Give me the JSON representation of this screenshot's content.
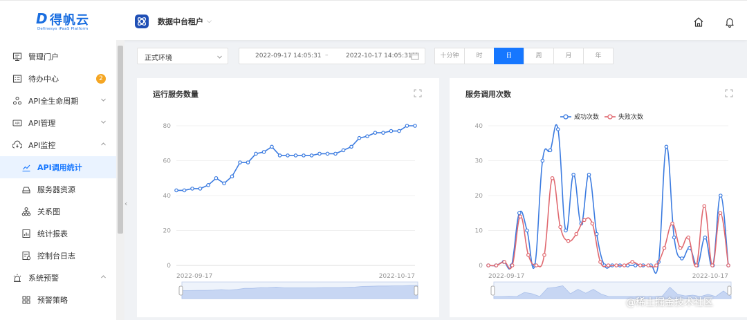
{
  "brand": {
    "mark": "D",
    "name": "得帆云",
    "subtitle": "Definesys iPaaS Platform"
  },
  "header": {
    "tenant": "数据中台租户",
    "home_icon": "home-icon",
    "bell_icon": "bell-icon"
  },
  "sidebar": {
    "items": [
      {
        "label": "管理门户",
        "icon": "monitor-icon"
      },
      {
        "label": "待办中心",
        "icon": "todo-icon",
        "badge": "2"
      },
      {
        "label": "API全生命周期",
        "icon": "lifecycle-icon",
        "expandable": true
      },
      {
        "label": "API管理",
        "icon": "api-icon",
        "expandable": true
      },
      {
        "label": "API监控",
        "icon": "cloud-monitor-icon",
        "expanded": true
      },
      {
        "label": "API调用统计",
        "icon": "chart-icon",
        "sub": true,
        "active": true
      },
      {
        "label": "服务器资源",
        "icon": "server-icon",
        "sub": true
      },
      {
        "label": "关系图",
        "icon": "relation-icon",
        "sub": true
      },
      {
        "label": "统计报表",
        "icon": "report-icon",
        "sub": true
      },
      {
        "label": "控制台日志",
        "icon": "log-icon",
        "sub": true
      },
      {
        "label": "系统预警",
        "icon": "alarm-icon",
        "expanded": true
      },
      {
        "label": "预警策略",
        "icon": "grid-icon",
        "sub": true
      }
    ]
  },
  "filters": {
    "environment": "正式环境",
    "date_start": "2022-09-17 14:05:31",
    "date_separator": "–",
    "date_end": "2022-10-17 14:05:31",
    "granularity": [
      "十分钟",
      "时",
      "日",
      "周",
      "月",
      "年"
    ],
    "granularity_active": "日"
  },
  "colors": {
    "primary": "#1677ff",
    "success_series": "#3b7be0",
    "fail_series": "#e0686f",
    "badge": "#f5a623"
  },
  "chart_data": [
    {
      "type": "line",
      "title": "运行服务数量",
      "ylim": [
        0,
        80
      ],
      "yticks": [
        0,
        20,
        40,
        60,
        80
      ],
      "xlabels": [
        "2022-09-17",
        "2022-10-17"
      ],
      "series": [
        {
          "values": [
            43,
            43,
            44,
            44,
            46,
            50,
            47,
            51,
            59,
            59,
            64,
            65,
            68,
            63,
            63,
            63,
            63,
            63,
            64,
            64,
            64,
            66,
            68,
            73,
            74,
            76,
            76,
            77,
            77,
            80,
            80
          ]
        }
      ]
    },
    {
      "type": "line",
      "title": "服务调用次数",
      "ylim": [
        0,
        40
      ],
      "yticks": [
        0,
        10,
        20,
        30,
        40
      ],
      "xlabels": [
        "2022-09-17",
        "2022-10-17"
      ],
      "legend": "top",
      "series": [
        {
          "name": "成功次数",
          "values": [
            0,
            0,
            1,
            0,
            15,
            10,
            0,
            30,
            33,
            39,
            10,
            26,
            12,
            26,
            9,
            0,
            0,
            0,
            0,
            0,
            0,
            0,
            1,
            34,
            8,
            2,
            5,
            0,
            8,
            0,
            20,
            0
          ]
        },
        {
          "name": "失败次数",
          "values": [
            0,
            0,
            1,
            0,
            14,
            3,
            0,
            3,
            25,
            11,
            7,
            9,
            13,
            12,
            1,
            0,
            0,
            0,
            1,
            0,
            0,
            0,
            5,
            12,
            5,
            8,
            0,
            17,
            0,
            15,
            0
          ]
        }
      ]
    }
  ],
  "watermark": "@稀土掘金技术社区"
}
